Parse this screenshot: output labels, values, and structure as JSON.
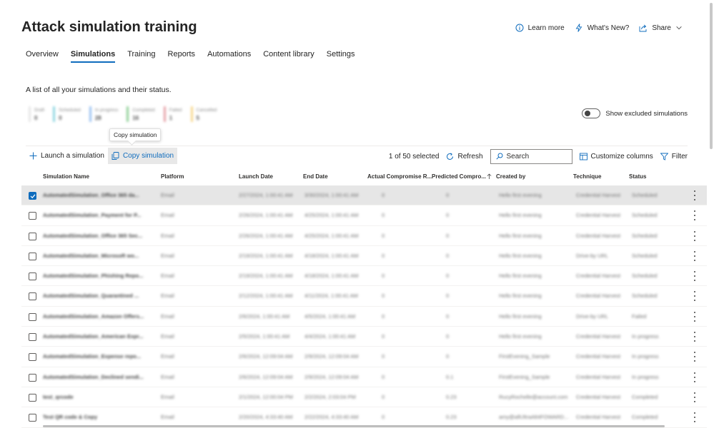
{
  "header": {
    "title": "Attack simulation training",
    "actions": [
      {
        "label": "Learn more",
        "icon": "info-icon"
      },
      {
        "label": "What's New?",
        "icon": "lightning-icon"
      },
      {
        "label": "Share",
        "icon": "share-icon"
      }
    ]
  },
  "tabs": [
    {
      "label": "Overview",
      "active": false
    },
    {
      "label": "Simulations",
      "active": true
    },
    {
      "label": "Training",
      "active": false
    },
    {
      "label": "Reports",
      "active": false
    },
    {
      "label": "Automations",
      "active": false
    },
    {
      "label": "Content library",
      "active": false
    },
    {
      "label": "Settings",
      "active": false
    }
  ],
  "description": "A list of all your simulations and their status.",
  "status_summary": [
    {
      "label": "Draft",
      "count": "0",
      "color": "#e6e6e6"
    },
    {
      "label": "Scheduled",
      "count": "0",
      "color": "#8fd6e1"
    },
    {
      "label": "In progress",
      "count": "28",
      "color": "#9bc3f2"
    },
    {
      "label": "Completed",
      "count": "16",
      "color": "#92d19a"
    },
    {
      "label": "Failed",
      "count": "1",
      "color": "#e7a3a9"
    },
    {
      "label": "Cancelled",
      "count": "5",
      "color": "#f7d88e"
    }
  ],
  "toggle_label": "Show excluded simulations",
  "tooltip": "Copy simulation",
  "toolbar": {
    "launch_label": "Launch a simulation",
    "copy_label": "Copy simulation",
    "selected_text": "1 of 50 selected",
    "refresh_label": "Refresh",
    "search_placeholder": "Search",
    "customize_label": "Customize columns",
    "filter_label": "Filter"
  },
  "columns": [
    "Simulation Name",
    "Platform",
    "Launch Date",
    "End Date",
    "Actual Compromise R...",
    "Predicted Compro...",
    "Created by",
    "Technique",
    "Status"
  ],
  "rows": [
    {
      "checked": true,
      "name": "AutomatedSimulation_Office 365 da...",
      "platform": "Email",
      "launch": "2/27/2024, 1:00:41 AM",
      "end": "3/30/2024, 1:00:41 AM",
      "actual": "0",
      "predicted": "0",
      "created": "Hello first evening",
      "technique": "Credential Harvest",
      "status": "Scheduled"
    },
    {
      "checked": false,
      "name": "AutomatedSimulation_Payment for P...",
      "platform": "Email",
      "launch": "2/26/2024, 1:00:41 AM",
      "end": "4/25/2024, 1:00:41 AM",
      "actual": "0",
      "predicted": "0",
      "created": "Hello first evening",
      "technique": "Credential Harvest",
      "status": "Scheduled"
    },
    {
      "checked": false,
      "name": "AutomatedSimulation_Office 365 Sec...",
      "platform": "Email",
      "launch": "2/26/2024, 1:00:41 AM",
      "end": "4/25/2024, 1:00:41 AM",
      "actual": "0",
      "predicted": "0",
      "created": "Hello first evening",
      "technique": "Credential Harvest",
      "status": "Scheduled"
    },
    {
      "checked": false,
      "name": "AutomatedSimulation_Microsoft wo...",
      "platform": "Email",
      "launch": "2/19/2024, 1:00:41 AM",
      "end": "4/18/2024, 1:00:41 AM",
      "actual": "0",
      "predicted": "0",
      "created": "Hello first evening",
      "technique": "Drive-by URL",
      "status": "Scheduled"
    },
    {
      "checked": false,
      "name": "AutomatedSimulation_Phishing Repo...",
      "platform": "Email",
      "launch": "2/19/2024, 1:00:41 AM",
      "end": "4/18/2024, 1:00:41 AM",
      "actual": "0",
      "predicted": "0",
      "created": "Hello first evening",
      "technique": "Credential Harvest",
      "status": "Scheduled"
    },
    {
      "checked": false,
      "name": "AutomatedSimulation_Quarantined ...",
      "platform": "Email",
      "launch": "2/12/2024, 1:00:41 AM",
      "end": "4/11/2024, 1:00:41 AM",
      "actual": "0",
      "predicted": "0",
      "created": "Hello first evening",
      "technique": "Credential Harvest",
      "status": "Scheduled"
    },
    {
      "checked": false,
      "name": "AutomatedSimulation_Amazon Offers...",
      "platform": "Email",
      "launch": "2/6/2024, 1:00:41 AM",
      "end": "4/5/2024, 1:00:41 AM",
      "actual": "0",
      "predicted": "0",
      "created": "Hello first evening",
      "technique": "Drive-by URL",
      "status": "Failed"
    },
    {
      "checked": false,
      "name": "AutomatedSimulation_American Expr...",
      "platform": "Email",
      "launch": "2/5/2024, 1:00:41 AM",
      "end": "4/4/2024, 1:00:41 AM",
      "actual": "0",
      "predicted": "0",
      "created": "Hello first evening",
      "technique": "Credential Harvest",
      "status": "In progress"
    },
    {
      "checked": false,
      "name": "AutomatedSimulation_Expense repo...",
      "platform": "Email",
      "launch": "2/6/2024, 12:09:04 AM",
      "end": "2/9/2024, 12:09:04 AM",
      "actual": "0",
      "predicted": "0",
      "created": "FirstEvening_Sample",
      "technique": "Credential Harvest",
      "status": "In progress"
    },
    {
      "checked": false,
      "name": "AutomatedSimulation_Declined sendi...",
      "platform": "Email",
      "launch": "2/6/2024, 12:09:04 AM",
      "end": "2/9/2024, 12:09:04 AM",
      "actual": "0",
      "predicted": "0.1",
      "created": "FirstEvening_Sample",
      "technique": "Credential Harvest",
      "status": "In progress"
    },
    {
      "checked": false,
      "name": "test_qrcode",
      "platform": "Email",
      "launch": "2/1/2024, 12:00:04 PM",
      "end": "2/2/2024, 2:03:04 PM",
      "actual": "0",
      "predicted": "0.23",
      "created": "RucyRochelle@account.com",
      "technique": "Credential Harvest",
      "status": "Completed"
    },
    {
      "checked": false,
      "name": "Test QR code & Copy",
      "platform": "Email",
      "launch": "2/20/2024, 4:33:40 AM",
      "end": "2/22/2024, 4:33:40 AM",
      "actual": "0",
      "predicted": "0.23",
      "created": "amy@allUltraAlt4FOWARD...",
      "technique": "Credential Harvest",
      "status": "Completed"
    }
  ]
}
